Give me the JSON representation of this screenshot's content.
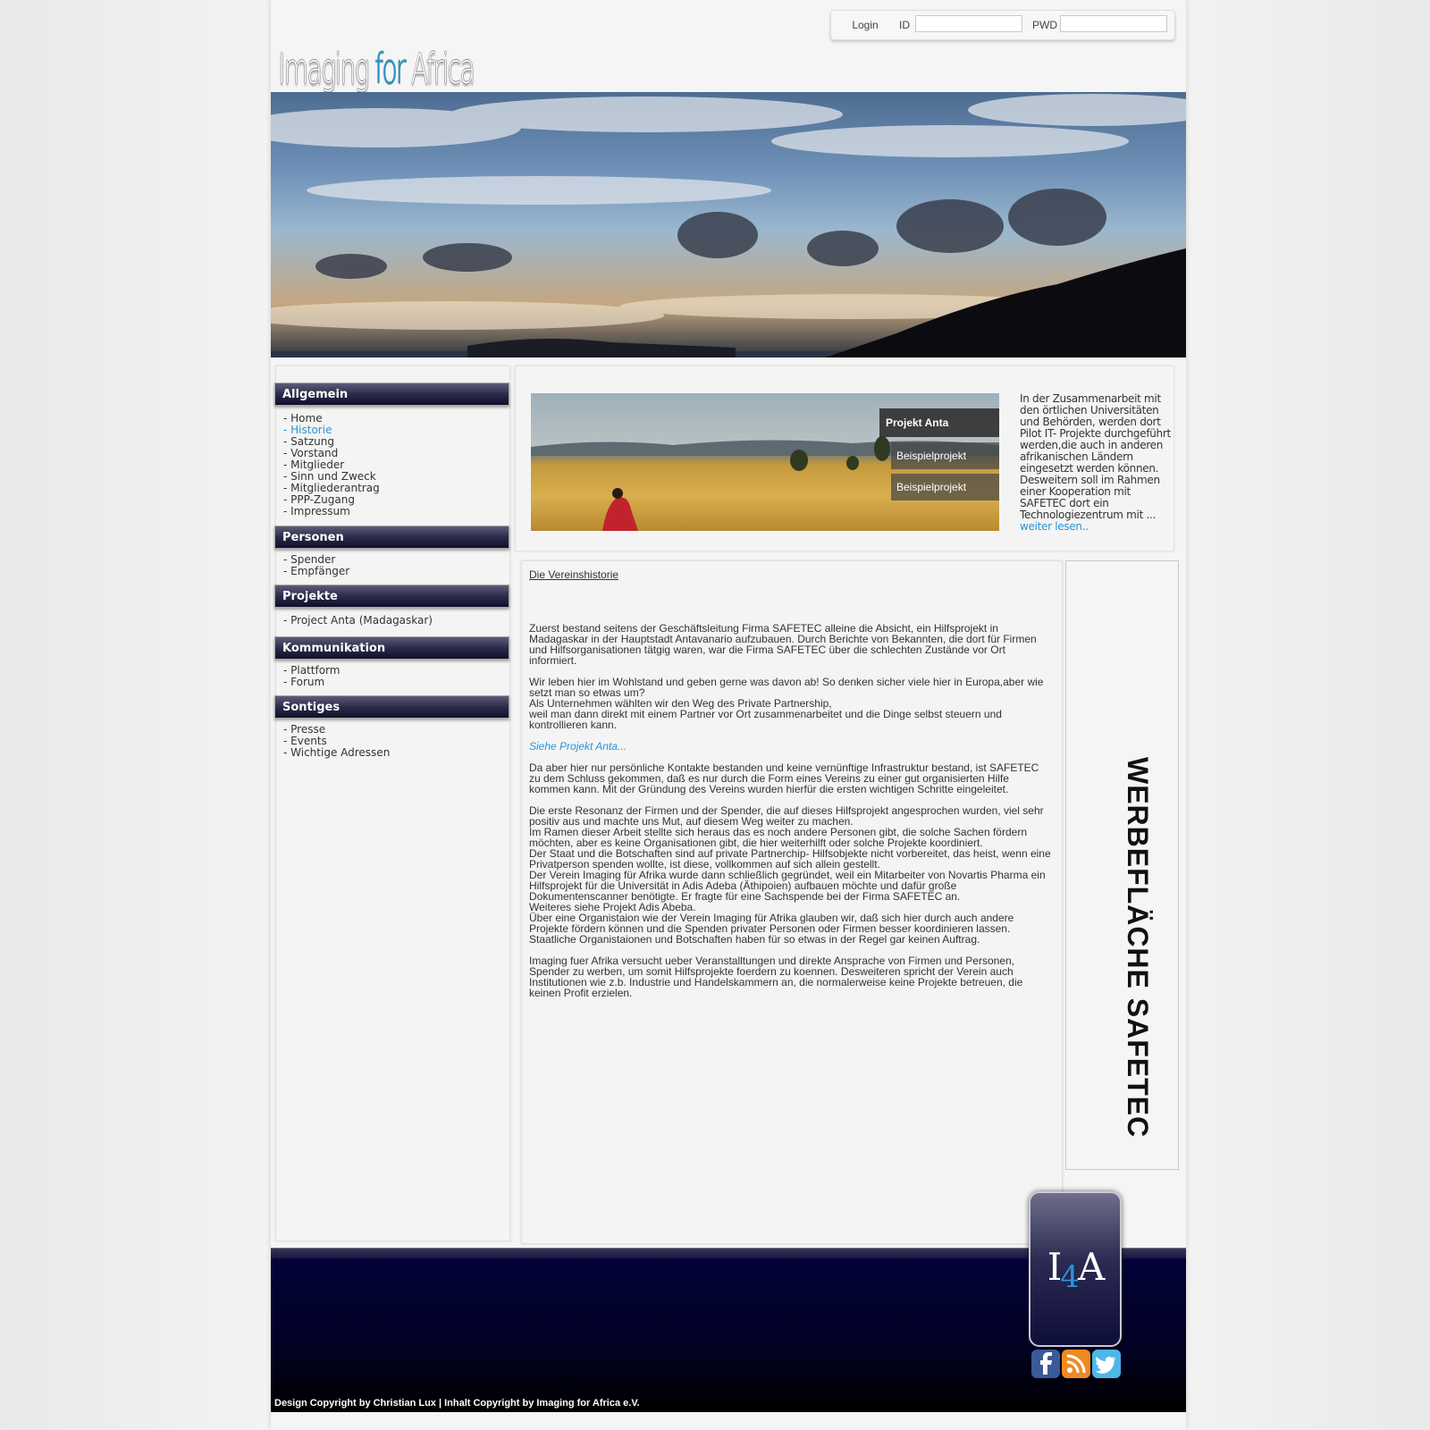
{
  "login": {
    "button": "Login",
    "id_label": "ID",
    "pwd_label": "PWD",
    "id_value": "",
    "pwd_value": ""
  },
  "logo": {
    "part1": "Imaging ",
    "part2": "for",
    "part3": " Africa"
  },
  "sidebar": {
    "sections": [
      {
        "title": "Allgemein",
        "items": [
          "- Home",
          "- Historie",
          "- Satzung",
          "- Vorstand",
          "- Mitglieder",
          "- Sinn und Zweck",
          "- Mitgliederantrag",
          "- PPP-Zugang",
          "- Impressum"
        ],
        "active": 1
      },
      {
        "title": "Personen",
        "items": [
          "- Spender",
          "- Empfänger"
        ]
      },
      {
        "title": "Projekte",
        "items": [
          "- Project Anta (Madagaskar)"
        ]
      },
      {
        "title": "Kommunikation",
        "items": [
          "- Plattform",
          "- Forum"
        ]
      },
      {
        "title": "Sontiges",
        "items": [
          "- Presse",
          "- Events",
          "- Wichtige Adressen"
        ]
      }
    ]
  },
  "featured": {
    "tabs": [
      "Projekt Anta",
      "Beispielprojekt",
      "Beispielprojekt"
    ],
    "text": "In der Zusammenarbeit mit den örtlichen Universitäten und Behörden, werden dort Pilot IT- Projekte durchgeführt werden,die auch in anderen afrikanischen Ländern eingesetzt werden können. Desweitern soll im Rahmen einer Kooperation mit SAFETEC  dort ein Technologiezentrum mit ...",
    "more": "weiter lesen.."
  },
  "content": {
    "title": "Die Vereinshistorie",
    "p1": "Zuerst bestand seitens der Geschäftsleitung Firma SAFETEC alleine die Absicht, ein Hilfsprojekt in Madagaskar in der Hauptstadt Antavanario aufzubauen. Durch Berichte von Bekannten, die dort für Firmen und Hilfsorganisationen tätgig waren, war die Firma SAFETEC über die schlechten Zustände vor Ort informiert.",
    "p2a": "Wir leben hier im Wohlstand und geben gerne was davon ab! So denken sicher viele hier in Europa,aber wie setzt man so etwas um?",
    "p2b": "Als Unternehmen wählten wir den Weg des Private Partnership,",
    "p2c": "weil man dann direkt mit einem Partner vor Ort zusammenarbeitet und die Dinge selbst steuern und kontrollieren kann.",
    "link": "Siehe Projekt Anta...",
    "p3": "Da aber hier nur persönliche Kontakte bestanden und keine vernünftige Infrastruktur bestand, ist SAFETEC zu dem Schluss gekommen, daß es nur durch die Form eines Vereins zu einer gut organisierten Hilfe kommen kann. Mit der Gründung des Vereins wurden hierfür die ersten wichtigen Schritte eingeleitet.",
    "p4a": "Die erste Resonanz der Firmen und der Spender, die auf dieses Hilfsprojekt angesprochen wurden, viel sehr positiv aus und machte uns Mut, auf diesem Weg weiter zu machen.",
    "p4b": "Im Ramen dieser Arbeit stellte sich heraus das es noch andere Personen gibt, die solche Sachen fördern möchten, aber es keine Organisationen gibt, die hier weiterhilft oder solche Projekte koordiniert.",
    "p4c": "Der Staat und die Botschaften sind auf private Partnerchip- Hilfsobjekte nicht vorbereitet, das heist, wenn eine Privatperson spenden wollte, ist diese, vollkommen auf sich allein gestellt.",
    "p4d": "Der Verein Imaging für Afrika wurde dann schließlich gegründet, weil ein Mitarbeiter von Novartis Pharma ein Hilfsprojekt für die Universität in Adis Adeba (Äthipoien) aufbauen möchte und dafür große Dokumentenscanner benötigte. Er fragte für eine Sachspende bei der Firma SAFETEC an.",
    "p4e": "Weiteres siehe Projekt Adis Abeba.",
    "p4f": "Über eine Organistaion wie der Verein Imaging für Afrika glauben wir, daß sich hier durch auch andere Projekte fördern können und die Spenden privater Personen oder Firmen besser koordinieren lassen.",
    "p4g": "Staatliche Organistaionen und Botschaften haben für so etwas in der Regel gar keinen Auftrag.",
    "p5": "Imaging fuer Afrika versucht ueber Veranstalltungen und direkte Ansprache von Firmen und Personen, Spender zu werben, um somit Hilfsprojekte foerdern zu koennen. Desweiteren spricht der Verein auch Institutionen wie z.b. Industrie und Handelskammern an, die normalerweise keine Projekte betreuen, die keinen Profit erzielen."
  },
  "ad": {
    "text": "WERBEFLÄCHE SAFETEC"
  },
  "footer": {
    "copyright": "Design Copyright by Christian Lux | Inhalt Copyright by Imaging for Africa e.V.",
    "badge": {
      "i": "I",
      "four": "4",
      "a": "A"
    }
  },
  "social": [
    {
      "icon": "facebook-icon",
      "color": "#3b5998"
    },
    {
      "icon": "rss-icon",
      "color": "#f08a24"
    },
    {
      "icon": "twitter-icon",
      "color": "#4fb6e8"
    }
  ]
}
